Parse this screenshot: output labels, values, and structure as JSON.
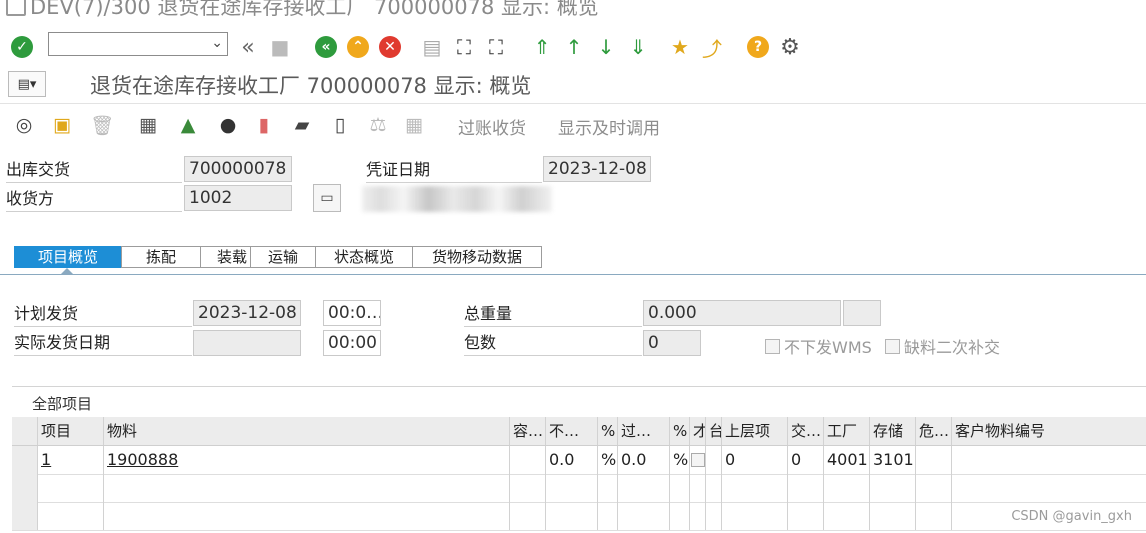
{
  "window": {
    "title": "DEV(7)/300 退货在途库存接收工厂 700000078 显示: 概览"
  },
  "screen": {
    "title": "退货在途库存接收工厂 700000078 显示: 概览"
  },
  "toolbar2": {
    "post_gr": "过账收货",
    "display_call": "显示及时调用"
  },
  "header": {
    "delivery_label": "出库交货",
    "delivery_value": "700000078",
    "receiver_label": "收货方",
    "receiver_value": "1002",
    "doc_date_label": "凭证日期",
    "doc_date_value": "2023-12-08"
  },
  "tabs": [
    "项目概览",
    "拣配",
    "装载",
    "运输",
    "状态概览",
    "货物移动数据"
  ],
  "overview": {
    "planned_gi_label": "计划发货",
    "planned_gi_date": "2023-12-08",
    "planned_gi_time": "00:0…",
    "actual_gi_label": "实际发货日期",
    "actual_gi_date": "",
    "actual_gi_time": "00:00",
    "total_weight_label": "总重量",
    "total_weight_value": "0.000",
    "weight_unit": "",
    "packages_label": "包数",
    "packages_value": "0",
    "chk_no_wms": "不下发WMS",
    "chk_shortage": "缺料二次补交"
  },
  "items_table": {
    "title": "全部项目",
    "columns": [
      "项目",
      "物料",
      "容…",
      "不…",
      "%",
      "过…",
      "%",
      "才",
      "台",
      "上层项",
      "交…",
      "工厂",
      "存储",
      "危…",
      "客户物料编号"
    ],
    "rows": [
      [
        "1",
        "1900888",
        "",
        "0.0",
        "%",
        "0.0",
        "%",
        "",
        "",
        "0",
        "0",
        "4001",
        "3101",
        "",
        ""
      ]
    ]
  },
  "watermark": "CSDN @gavin_gxh"
}
